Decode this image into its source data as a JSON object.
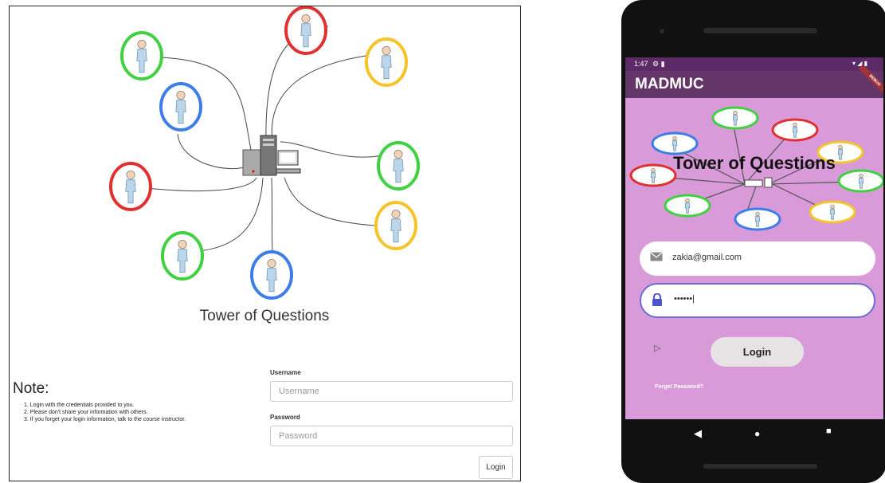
{
  "web": {
    "title": "Tower of Questions",
    "note": {
      "heading": "Note:",
      "items": [
        "1. Login with the credentials provided to you.",
        "2. Please don't share your information with others.",
        "3. If you forget your login information, talk to the course instructor."
      ]
    },
    "form": {
      "username_label": "Username",
      "username_placeholder": "Username",
      "password_label": "Password",
      "password_placeholder": "Password",
      "login_label": "Login"
    }
  },
  "phone": {
    "status_time": "1:47",
    "status_icons": "⚙ ▮",
    "status_right": "▾ ◢ ▮",
    "debug_banner": "DEBUG",
    "app_title": "MADMUC",
    "logo_text": "Tower of Questions",
    "email_value": "zakia@gmail.com",
    "password_value": "••••••|",
    "login_label": "Login",
    "forgot_label": "Forget Password?"
  },
  "colors": {
    "ring_green": "#3fd13f",
    "ring_red": "#e03030",
    "ring_blue": "#3d7de8",
    "ring_yellow": "#f5c42a",
    "app_bar": "#633568",
    "screen_bg": "#d99ad9"
  },
  "icons": [
    "user-ring-icon",
    "server-tower-icon",
    "desktop-monitor-icon",
    "mail-icon",
    "lock-icon",
    "cursor-icon",
    "nav-back-icon",
    "nav-home-icon",
    "nav-recent-icon"
  ]
}
